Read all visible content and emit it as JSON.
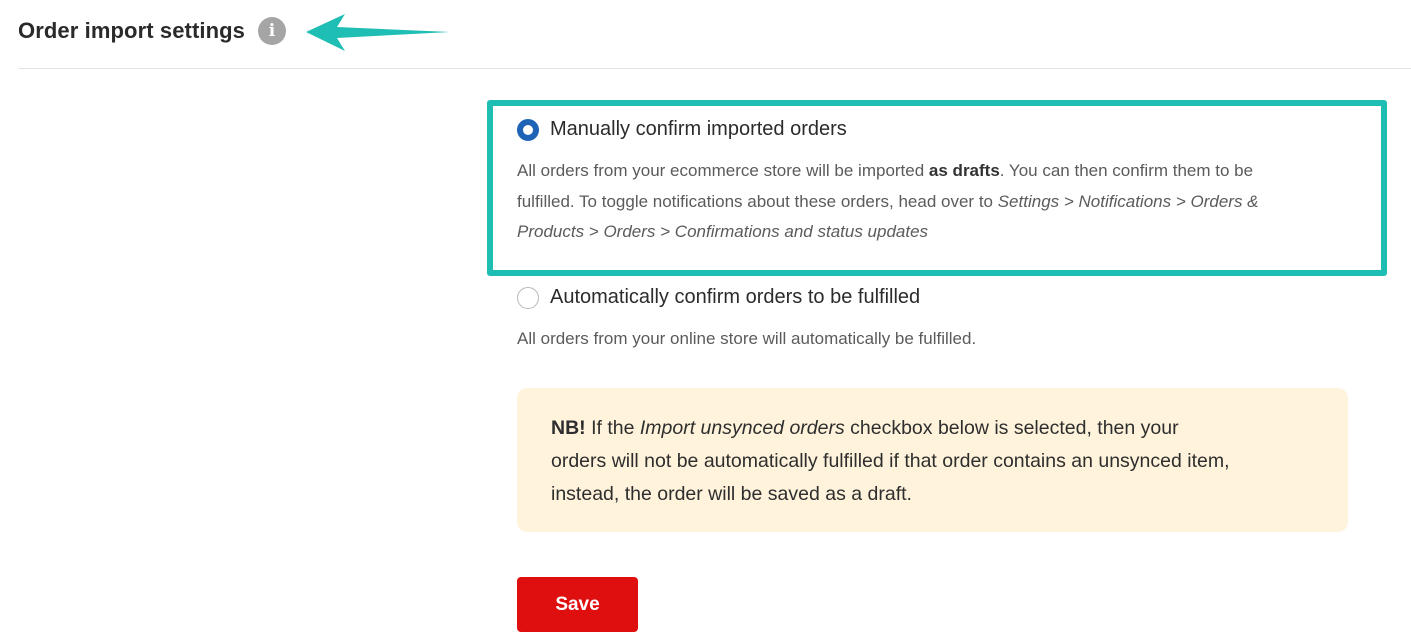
{
  "header": {
    "title": "Order import settings",
    "info_icon": "info-icon",
    "info_glyph": "i"
  },
  "annotation": {
    "arrow_color": "#1fbeb4",
    "highlight_color": "#1fbeb4"
  },
  "options": [
    {
      "label": "Manually confirm imported orders",
      "selected": true,
      "desc": {
        "l1_a": "All orders from your ecommerce store will be imported ",
        "l1_b": "as drafts",
        "l1_c": ". You can then confirm them to be",
        "l2_a": "fulfilled. To toggle notifications about these orders, head over to ",
        "l2_b": "Settings > Notifications > Orders &",
        "l3": "Products > Orders > Confirmations and status updates"
      }
    },
    {
      "label": "Automatically confirm orders to be fulfilled",
      "selected": false,
      "desc": "All orders from your online store will automatically be fulfilled."
    }
  ],
  "notice": {
    "bg_color": "#fff3dc",
    "l1_a": "NB!",
    "l1_b": " If the ",
    "l1_c": "Import unsynced orders",
    "l1_d": " checkbox below is selected, then your",
    "l2": "orders will not be automatically fulfilled if that order contains an unsynced item,",
    "l3": "instead, the order will be saved as a draft."
  },
  "save_button": {
    "label": "Save",
    "color": "#e00f0f"
  },
  "colors": {
    "radio_selected": "#1e63b5"
  }
}
